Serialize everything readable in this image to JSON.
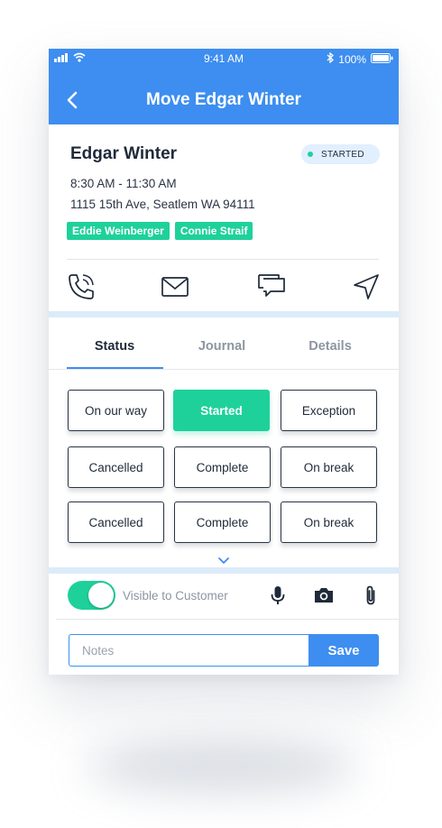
{
  "status_bar": {
    "time": "9:41 AM",
    "battery": "100%"
  },
  "header": {
    "title": "Move Edgar Winter"
  },
  "job": {
    "customer": "Edgar Winter",
    "status": "STARTED",
    "time_range": "8:30 AM - 11:30 AM",
    "address": "1115 15th Ave, Seatlem WA 94111",
    "crew": [
      "Eddie Weinberger",
      "Connie Straif"
    ]
  },
  "tabs": [
    {
      "label": "Status",
      "active": true
    },
    {
      "label": "Journal",
      "active": false
    },
    {
      "label": "Details",
      "active": false
    }
  ],
  "status_options": [
    [
      "On our way",
      "Started",
      "Exception"
    ],
    [
      "Cancelled",
      "Complete",
      "On break"
    ],
    [
      "Cancelled",
      "Complete",
      "On break"
    ]
  ],
  "selected_status": "Started",
  "visibility": {
    "label": "Visible to Customer",
    "enabled": true
  },
  "notes": {
    "placeholder": "Notes",
    "value": ""
  },
  "save_label": "Save",
  "colors": {
    "primary": "#3d8ef0",
    "success": "#1ed19a",
    "badge_bg": "#e1efff",
    "band": "#dcebfa",
    "text_dark": "#1f2a3a",
    "text_muted": "#8d95a2"
  },
  "icons": {
    "actions": [
      "phone-icon",
      "mail-icon",
      "chat-icon",
      "navigate-icon"
    ],
    "tools": [
      "microphone-icon",
      "camera-icon",
      "paperclip-icon"
    ]
  }
}
